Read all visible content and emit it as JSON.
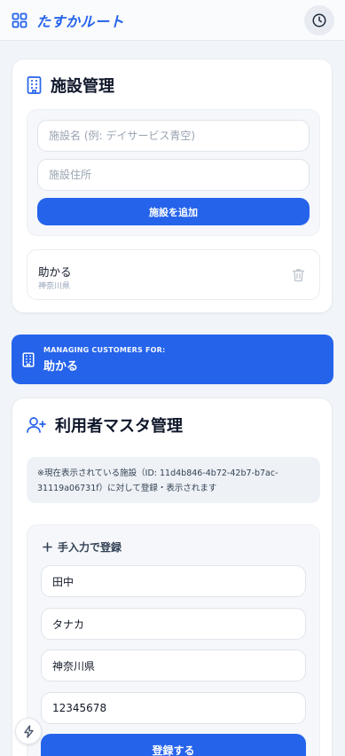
{
  "app": {
    "name": "たすかルート"
  },
  "facility_section": {
    "title": "施設管理",
    "name_placeholder": "施設名 (例: デイサービス青空)",
    "address_placeholder": "施設住所",
    "add_button": "施設を追加",
    "facilities": [
      {
        "name": "助かる",
        "address": "神奈川県"
      }
    ]
  },
  "banner": {
    "label": "MANAGING CUSTOMERS FOR:",
    "facility": "助かる"
  },
  "customer_section": {
    "title": "利用者マスタ管理",
    "notice": "※現在表示されている施設（ID: 11d4b846-4b72-42b7-b7ac-31119a06731f）に対して登録・表示されます",
    "manual_entry_label": "手入力で登録",
    "fields": {
      "name": "田中",
      "kana": "タナカ",
      "address": "神奈川県",
      "phone": "12345678"
    },
    "register_button": "登録する"
  },
  "colors": {
    "accent": "#2563eb",
    "background": "#f1f4f8",
    "card": "#ffffff"
  },
  "icons": {
    "header_left": "grid-icon",
    "header_right": "history-icon",
    "facility_title": "building-icon",
    "delete": "trash-icon",
    "banner": "building-icon",
    "customer_title": "user-plus-icon",
    "manual_entry": "plus-icon",
    "fab": "bolt-icon"
  }
}
